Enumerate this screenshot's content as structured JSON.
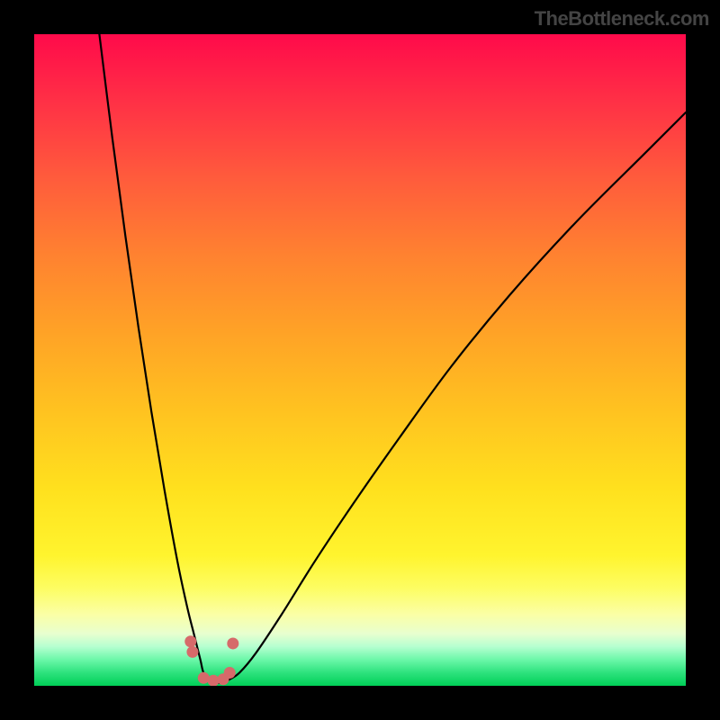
{
  "watermark": "TheBottleneck.com",
  "chart_data": {
    "type": "line",
    "title": "",
    "xlabel": "",
    "ylabel": "",
    "xlim": [
      0,
      100
    ],
    "ylim": [
      0,
      100
    ],
    "grid": false,
    "series": [
      {
        "name": "bottleneck-curve",
        "x": [
          10,
          12,
          14,
          16,
          18,
          20,
          22,
          23.5,
          24.5,
          25.5,
          26,
          27,
          28,
          29,
          30,
          31.5,
          34,
          38,
          43,
          49,
          56,
          64,
          73,
          83,
          94,
          100
        ],
        "y": [
          100,
          84,
          69,
          55,
          42,
          30,
          19,
          12,
          8,
          4,
          2,
          1,
          0.5,
          0.5,
          1,
          2,
          5,
          11,
          19,
          28,
          38,
          49,
          60,
          71,
          82,
          88
        ]
      }
    ],
    "markers": {
      "name": "optimal-points",
      "x": [
        24,
        24.3,
        26,
        27.5,
        29,
        30,
        30.5
      ],
      "y": [
        6.8,
        5.2,
        1.2,
        0.8,
        1.0,
        2.0,
        6.5
      ]
    },
    "gradient_stops": [
      {
        "pos": 0,
        "color": "#ff0a4a"
      },
      {
        "pos": 10,
        "color": "#ff2f46"
      },
      {
        "pos": 22,
        "color": "#ff5b3c"
      },
      {
        "pos": 34,
        "color": "#ff8230"
      },
      {
        "pos": 46,
        "color": "#ffa326"
      },
      {
        "pos": 58,
        "color": "#ffc320"
      },
      {
        "pos": 70,
        "color": "#ffe11e"
      },
      {
        "pos": 80,
        "color": "#fff42e"
      },
      {
        "pos": 85,
        "color": "#fdfd62"
      },
      {
        "pos": 89,
        "color": "#fbffa5"
      },
      {
        "pos": 92,
        "color": "#e8ffcf"
      },
      {
        "pos": 94,
        "color": "#b5ffd0"
      },
      {
        "pos": 96,
        "color": "#6bf7a8"
      },
      {
        "pos": 98,
        "color": "#2de27d"
      },
      {
        "pos": 100,
        "color": "#00cf57"
      }
    ]
  }
}
